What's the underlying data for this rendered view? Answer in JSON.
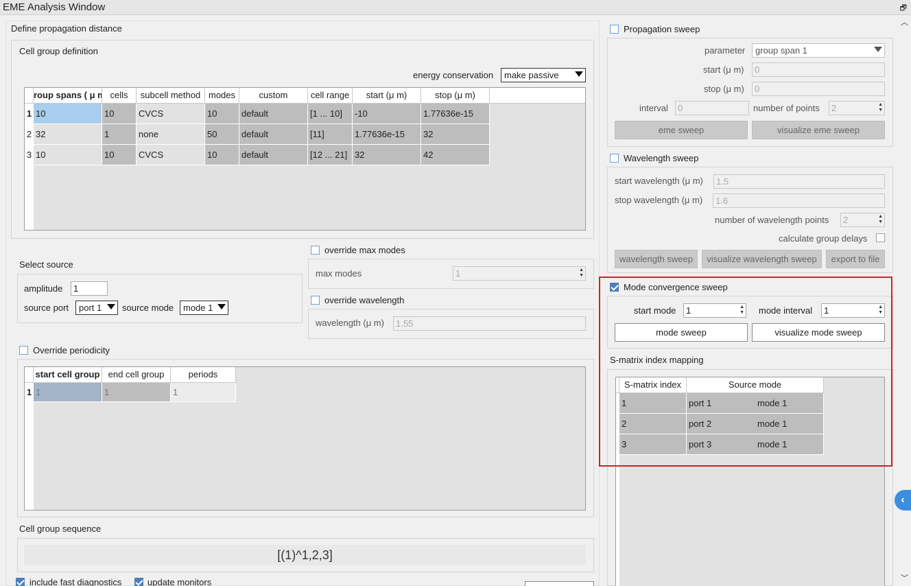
{
  "window": {
    "title": "EME Analysis Window",
    "restore_glyph": "🗗"
  },
  "left": {
    "propagation_title": "Define propagation distance",
    "cell_group_title": "Cell group definition",
    "energy_label": "energy conservation",
    "energy_value": "make passive",
    "cell_table": {
      "headers": [
        "roup spans ( μ m",
        "cells",
        "subcell method",
        "modes",
        "custom",
        "cell range",
        "start (μ m)",
        "stop (μ m)"
      ],
      "row_numbers": [
        "1",
        "2",
        "3"
      ],
      "rows": [
        [
          "10",
          "10",
          "CVCS",
          "10",
          "default",
          "[1 ... 10]",
          "-10",
          "1.77636e-15"
        ],
        [
          "32",
          "1",
          "none",
          "50",
          "default",
          "[11]",
          "1.77636e-15",
          "32"
        ],
        [
          "10",
          "10",
          "CVCS",
          "10",
          "default",
          "[12 ... 21]",
          "32",
          "42"
        ]
      ]
    },
    "select_source_title": "Select source",
    "amplitude_label": "amplitude",
    "amplitude_value": "1",
    "source_port_label": "source port",
    "source_port_value": "port 1",
    "source_mode_label": "source mode",
    "source_mode_value": "mode 1",
    "override_max_modes_label": "override max modes",
    "max_modes_label": "max modes",
    "max_modes_value": "1",
    "override_wavelength_label": "override wavelength",
    "wavelength_label": "wavelength (μ m)",
    "wavelength_value": "1.55",
    "override_periodicity_label": "Override periodicity",
    "period_table": {
      "headers": [
        "start cell group",
        "end cell group",
        "periods"
      ],
      "row_numbers": [
        "1"
      ],
      "rows": [
        [
          "1",
          "1",
          "1"
        ]
      ]
    },
    "cell_group_sequence_title": "Cell group sequence",
    "cell_group_sequence_value": "[(1)^1,2,3]",
    "include_fast_diagnostics_label": "include fast diagnostics",
    "update_monitors_label": "update monitors"
  },
  "right": {
    "propagation_sweep": {
      "label": "Propagation sweep",
      "parameter_label": "parameter",
      "parameter_value": "group span 1",
      "start_label": "start (μ m)",
      "start_value": "0",
      "stop_label": "stop (μ m)",
      "stop_value": "0",
      "interval_label": "interval",
      "interval_value": "0",
      "points_label": "number of points",
      "points_value": "2",
      "eme_sweep_btn": "eme sweep",
      "visualize_btn": "visualize eme sweep"
    },
    "wavelength_sweep": {
      "label": "Wavelength sweep",
      "start_label": "start wavelength (μ m)",
      "start_value": "1.5",
      "stop_label": "stop wavelength (μ m)",
      "stop_value": "1.6",
      "points_label": "number of wavelength points",
      "points_value": "2",
      "group_delays_label": "calculate group delays",
      "sweep_btn": "wavelength sweep",
      "visualize_btn": "visualize wavelength sweep",
      "export_btn": "export to file"
    },
    "mode_convergence": {
      "label": "Mode convergence sweep",
      "start_mode_label": "start mode",
      "start_mode_value": "1",
      "interval_label": "mode interval",
      "interval_value": "1",
      "sweep_btn": "mode sweep",
      "visualize_btn": "visualize mode sweep"
    },
    "smatrix": {
      "title": "S-matrix index mapping",
      "headers": [
        "S-matrix index",
        "Source mode"
      ],
      "rows": [
        [
          "1",
          "port 1",
          "mode 1"
        ],
        [
          "2",
          "port 2",
          "mode 1"
        ],
        [
          "3",
          "port 3",
          "mode 1"
        ]
      ]
    }
  },
  "colors": {
    "highlight": "#d0202a",
    "selected_cell": "#a9cdec",
    "checkbox": "#4d7fb8",
    "side_tab": "#3b8de0"
  }
}
